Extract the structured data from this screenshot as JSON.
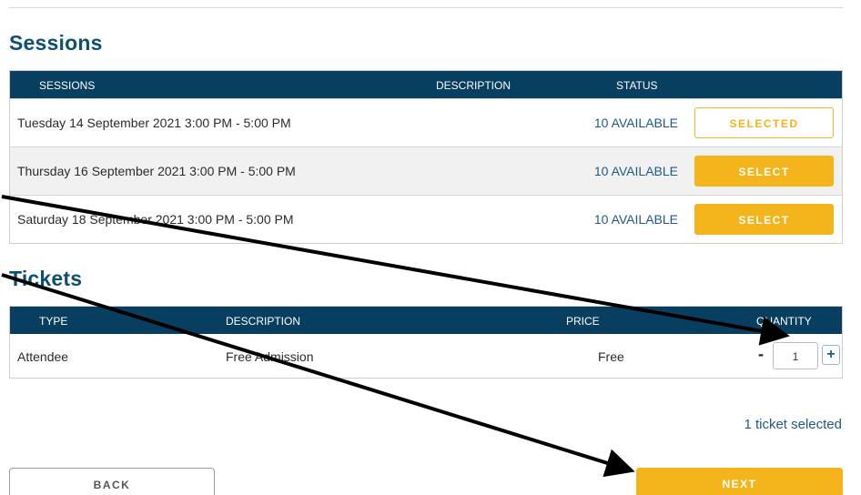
{
  "sessions": {
    "title": "Sessions",
    "headers": {
      "sessions": "SESSIONS",
      "description": "DESCRIPTION",
      "status": "STATUS"
    },
    "rows": [
      {
        "date": "Tuesday 14 September 2021 3:00 PM - 5:00 PM",
        "status": "10 AVAILABLE",
        "button": "SELECTED"
      },
      {
        "date": "Thursday 16 September 2021 3:00 PM - 5:00 PM",
        "status": "10 AVAILABLE",
        "button": "SELECT"
      },
      {
        "date": "Saturday 18 September 2021 3:00 PM - 5:00 PM",
        "status": "10 AVAILABLE",
        "button": "SELECT"
      }
    ]
  },
  "tickets": {
    "title": "Tickets",
    "headers": {
      "type": "TYPE",
      "description": "DESCRIPTION",
      "price": "PRICE",
      "quantity": "QUANTITY"
    },
    "rows": [
      {
        "type": "Attendee",
        "description": "Free Admission",
        "price": "Free",
        "quantity": "1",
        "minus": "-",
        "plus": "+"
      }
    ],
    "selected_text": "1 ticket selected"
  },
  "buttons": {
    "back": "BACK",
    "next": "NEXT"
  },
  "colors": {
    "header_bg": "#083e5f",
    "title": "#0d4f75",
    "accent": "#f3b51b",
    "status_text": "#1f5a86"
  }
}
